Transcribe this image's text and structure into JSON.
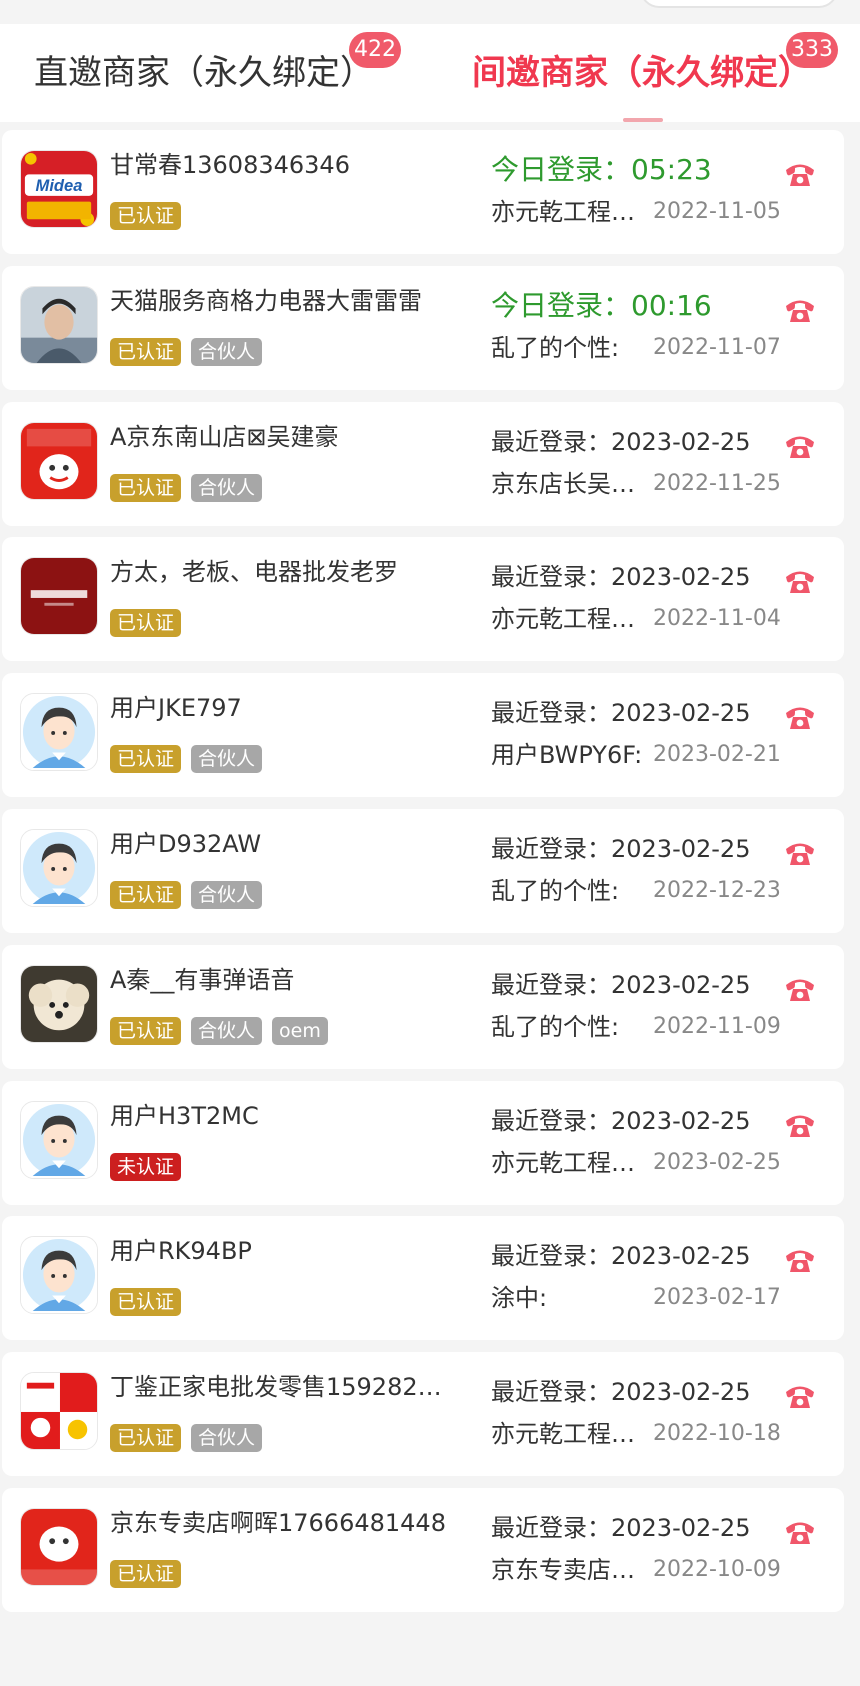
{
  "tabs": [
    {
      "label": "直邀商家（永久绑定）",
      "badge": "422",
      "active": false
    },
    {
      "label": "间邀商家（永久绑定）",
      "badge": "333",
      "active": true
    }
  ],
  "merchants": [
    {
      "name": "甘常春13608346346",
      "avatar": "midea-logo",
      "tags": [
        "已认证"
      ],
      "login": "今日登录：05:23",
      "login_today": true,
      "inviter": "亦元乾工程…",
      "date": "2022-11-05"
    },
    {
      "name": "天猫服务商格力电器大雷雷雷",
      "avatar": "person-photo",
      "tags": [
        "已认证",
        "合伙人"
      ],
      "login": "今日登录：00:16",
      "login_today": true,
      "inviter": "乱了的个性:",
      "date": "2022-11-07"
    },
    {
      "name": "A京东南山店⊠吴建豪",
      "avatar": "jd-appliance-logo",
      "tags": [
        "已认证",
        "合伙人"
      ],
      "login": "最近登录：2023-02-25",
      "login_today": false,
      "inviter": "京东店长吴…",
      "date": "2022-11-25"
    },
    {
      "name": "方太，老板、电器批发老罗",
      "avatar": "fotile-logo",
      "tags": [
        "已认证"
      ],
      "login": "最近登录：2023-02-25",
      "login_today": false,
      "inviter": "亦元乾工程…",
      "date": "2022-11-04"
    },
    {
      "name": "用户JKE797",
      "avatar": "default-user-avatar",
      "tags": [
        "已认证",
        "合伙人"
      ],
      "login": "最近登录：2023-02-25",
      "login_today": false,
      "inviter": "用户BWPY6F:",
      "date": "2023-02-21"
    },
    {
      "name": "用户D932AW",
      "avatar": "default-user-avatar",
      "tags": [
        "已认证",
        "合伙人"
      ],
      "login": "最近登录：2023-02-25",
      "login_today": false,
      "inviter": "乱了的个性:",
      "date": "2022-12-23"
    },
    {
      "name": "A秦__有事弹语音",
      "avatar": "dog-photo",
      "tags": [
        "已认证",
        "合伙人",
        "oem"
      ],
      "login": "最近登录：2023-02-25",
      "login_today": false,
      "inviter": "乱了的个性:",
      "date": "2022-11-09"
    },
    {
      "name": "用户H3T2MC",
      "avatar": "default-user-avatar",
      "tags": [
        "未认证"
      ],
      "login": "最近登录：2023-02-25",
      "login_today": false,
      "inviter": "亦元乾工程…",
      "date": "2023-02-25"
    },
    {
      "name": "用户RK94BP",
      "avatar": "default-user-avatar",
      "tags": [
        "已认证"
      ],
      "login": "最近登录：2023-02-25",
      "login_today": false,
      "inviter": "涂中:",
      "date": "2023-02-17"
    },
    {
      "name": "丁鉴正家电批发零售1592828…",
      "avatar": "tmall-suning-logo",
      "tags": [
        "已认证",
        "合伙人"
      ],
      "login": "最近登录：2023-02-25",
      "login_today": false,
      "inviter": "亦元乾工程…",
      "date": "2022-10-18"
    },
    {
      "name": "京东专卖店啊晖17666481448",
      "avatar": "jd-home-appliance-logo",
      "tags": [
        "已认证"
      ],
      "login": "最近登录：2023-02-25",
      "login_today": false,
      "inviter": "京东专卖店…",
      "date": "2022-10-09"
    }
  ],
  "icons": {
    "call": "phone-icon"
  },
  "colors": {
    "accent": "#f0384f",
    "badge": "#f05a6a",
    "today_login": "#2e9a2e",
    "verified_tag": "#c8a02c",
    "unverified_tag": "#cc1f1f",
    "partner_tag": "#a7a7a7",
    "phone_icon": "#f0566a"
  }
}
